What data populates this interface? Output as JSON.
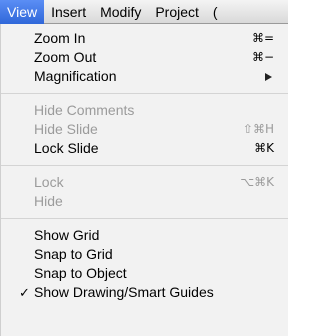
{
  "menubar": {
    "items": [
      "View",
      "Insert",
      "Modify",
      "Project",
      "("
    ]
  },
  "view_menu": {
    "zoom_in": {
      "label": "Zoom In",
      "shortcut": "⌘="
    },
    "zoom_out": {
      "label": "Zoom Out",
      "shortcut": "⌘−"
    },
    "magnification": {
      "label": "Magnification"
    },
    "hide_comments": {
      "label": "Hide Comments"
    },
    "hide_slide": {
      "label": "Hide Slide",
      "shortcut": "⇧⌘H"
    },
    "lock_slide": {
      "label": "Lock Slide",
      "shortcut": "⌘K"
    },
    "lock": {
      "label": "Lock",
      "shortcut": "⌥⌘K"
    },
    "hide": {
      "label": "Hide"
    },
    "show_grid": {
      "label": "Show Grid"
    },
    "snap_to_grid": {
      "label": "Snap to Grid"
    },
    "snap_to_object": {
      "label": "Snap to Object"
    },
    "show_guides": {
      "label": "Show Drawing/Smart Guides",
      "check": "✓"
    }
  }
}
